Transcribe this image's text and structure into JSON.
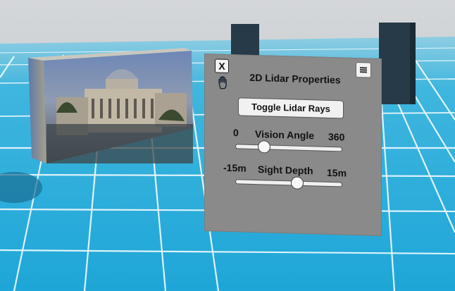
{
  "panel": {
    "close_label": "X",
    "title": "2D Lidar Properties",
    "menu_icon": "hamburger-icon",
    "hand_icon": "hand-icon",
    "toggle_button": "Toggle Lidar Rays",
    "vision_angle": {
      "min": "0",
      "label": "Vision Angle",
      "max": "360",
      "value": 0.27
    },
    "sight_depth": {
      "min": "-15m",
      "label": "Sight Depth",
      "max": "15m",
      "value": 0.58
    }
  },
  "colors": {
    "floor": "#27b0dd",
    "panel": "#8a8a8a",
    "sky": "#c8ccd0",
    "block": "#263a48"
  }
}
